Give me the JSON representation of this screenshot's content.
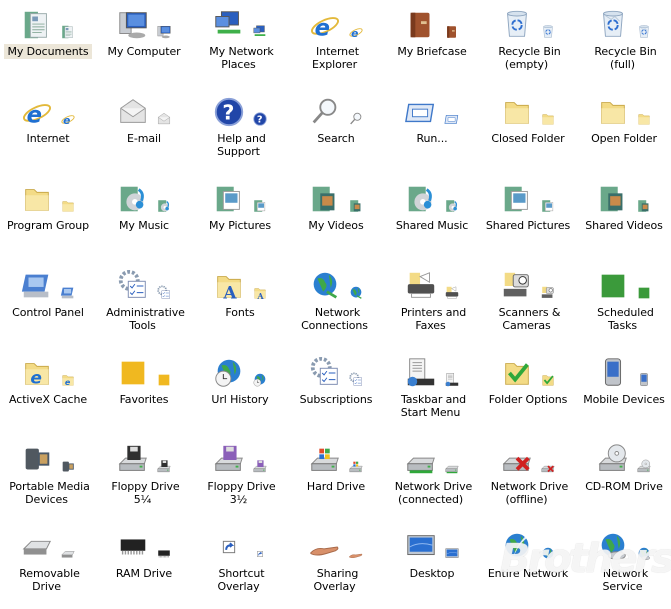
{
  "selected_index": 0,
  "icons": [
    {
      "label": "My Documents",
      "icon": "documents-folder-icon",
      "color": "#6aa88a"
    },
    {
      "label": "My Computer",
      "icon": "computer-icon",
      "color": "#2a5fbf"
    },
    {
      "label": "My Network Places",
      "icon": "network-places-icon",
      "color": "#2a5fbf"
    },
    {
      "label": "Internet Explorer",
      "icon": "internet-explorer-icon",
      "color": "#1f6fd1"
    },
    {
      "label": "My Briefcase",
      "icon": "briefcase-icon",
      "color": "#a0522d"
    },
    {
      "label": "Recycle Bin (empty)",
      "icon": "recycle-bin-empty-icon",
      "color": "#9fb8d6"
    },
    {
      "label": "Recycle Bin (full)",
      "icon": "recycle-bin-full-icon",
      "color": "#9fb8d6"
    },
    {
      "label": "Internet",
      "icon": "internet-icon",
      "color": "#1f6fd1"
    },
    {
      "label": "E-mail",
      "icon": "email-envelope-icon",
      "color": "#b8b8b8"
    },
    {
      "label": "Help and Support",
      "icon": "help-question-icon",
      "color": "#2146a8"
    },
    {
      "label": "Search",
      "icon": "search-magnifier-icon",
      "color": "#888888"
    },
    {
      "label": "Run...",
      "icon": "run-window-icon",
      "color": "#3f78c9"
    },
    {
      "label": "Closed Folder",
      "icon": "closed-folder-icon",
      "color": "#f2d77e"
    },
    {
      "label": "Open Folder",
      "icon": "open-folder-icon",
      "color": "#f2d77e"
    },
    {
      "label": "Program Group",
      "icon": "program-group-folder-icon",
      "color": "#f2d77e"
    },
    {
      "label": "My Music",
      "icon": "music-folder-icon",
      "color": "#2b8fd6"
    },
    {
      "label": "My Pictures",
      "icon": "pictures-folder-icon",
      "color": "#5a9ac8"
    },
    {
      "label": "My Videos",
      "icon": "videos-folder-icon",
      "color": "#3a6f6a"
    },
    {
      "label": "Shared Music",
      "icon": "shared-music-folder-icon",
      "color": "#2b8fd6"
    },
    {
      "label": "Shared Pictures",
      "icon": "shared-pictures-folder-icon",
      "color": "#5a9ac8"
    },
    {
      "label": "Shared Videos",
      "icon": "shared-videos-folder-icon",
      "color": "#3a6f6a"
    },
    {
      "label": "Control Panel",
      "icon": "control-panel-icon",
      "color": "#4a7fd0"
    },
    {
      "label": "Administrative Tools",
      "icon": "admin-tools-gear-icon",
      "color": "#8a9bb0"
    },
    {
      "label": "Fonts",
      "icon": "fonts-folder-icon",
      "color": "#2a5fbf"
    },
    {
      "label": "Network Connections",
      "icon": "network-connections-globe-icon",
      "color": "#2f8a3a"
    },
    {
      "label": "Printers and Faxes",
      "icon": "printer-icon",
      "color": "#505050"
    },
    {
      "label": "Scanners & Cameras",
      "icon": "scanner-camera-icon",
      "color": "#606060"
    },
    {
      "label": "Scheduled Tasks",
      "icon": "scheduled-tasks-clock-icon",
      "color": "#3b9a3b"
    },
    {
      "label": "ActiveX Cache",
      "icon": "activex-cache-folder-icon",
      "color": "#1f6fd1"
    },
    {
      "label": "Favorites",
      "icon": "favorites-star-icon",
      "color": "#f0b820"
    },
    {
      "label": "Url History",
      "icon": "url-history-clock-globe-icon",
      "color": "#2a7fd0"
    },
    {
      "label": "Subscriptions",
      "icon": "subscriptions-gear-icon",
      "color": "#8a9bb0"
    },
    {
      "label": "Taskbar and Start Menu",
      "icon": "taskbar-start-menu-icon",
      "color": "#333333"
    },
    {
      "label": "Folder Options",
      "icon": "folder-options-check-icon",
      "color": "#2fa83a"
    },
    {
      "label": "Mobile Devices",
      "icon": "mobile-device-pda-icon",
      "color": "#3a6fc8"
    },
    {
      "label": "Portable Media Devices",
      "icon": "camcorder-icon",
      "color": "#505860"
    },
    {
      "label": "Floppy Drive 5¼",
      "icon": "floppy-drive-5-icon",
      "color": "#303030"
    },
    {
      "label": "Floppy Drive 3½",
      "icon": "floppy-drive-3-icon",
      "color": "#8a5fb8"
    },
    {
      "label": "Hard Drive",
      "icon": "hard-drive-windows-icon",
      "color": "#8a8a8a"
    },
    {
      "label": "Network Drive (connected)",
      "icon": "network-drive-connected-icon",
      "color": "#2fa83a"
    },
    {
      "label": "Network Drive (offline)",
      "icon": "network-drive-offline-icon",
      "color": "#d02020"
    },
    {
      "label": "CD-ROM Drive",
      "icon": "cdrom-drive-icon",
      "color": "#8a8a8a"
    },
    {
      "label": "Removable Drive",
      "icon": "removable-drive-icon",
      "color": "#909090"
    },
    {
      "label": "RAM Drive",
      "icon": "ram-chip-icon",
      "color": "#222222"
    },
    {
      "label": "Shortcut Overlay",
      "icon": "shortcut-arrow-icon",
      "color": "#2a5fbf"
    },
    {
      "label": "Sharing Overlay",
      "icon": "sharing-hand-icon",
      "color": "#d8906a"
    },
    {
      "label": "Desktop",
      "icon": "desktop-monitor-icon",
      "color": "#2a6fd0"
    },
    {
      "label": "Entire Network",
      "icon": "entire-network-globe-icon",
      "color": "#2a7fd0"
    },
    {
      "label": "Network Service",
      "icon": "network-service-globe-icon",
      "color": "#2a7fd0"
    }
  ],
  "watermark": {
    "text": "Brothersoft"
  }
}
